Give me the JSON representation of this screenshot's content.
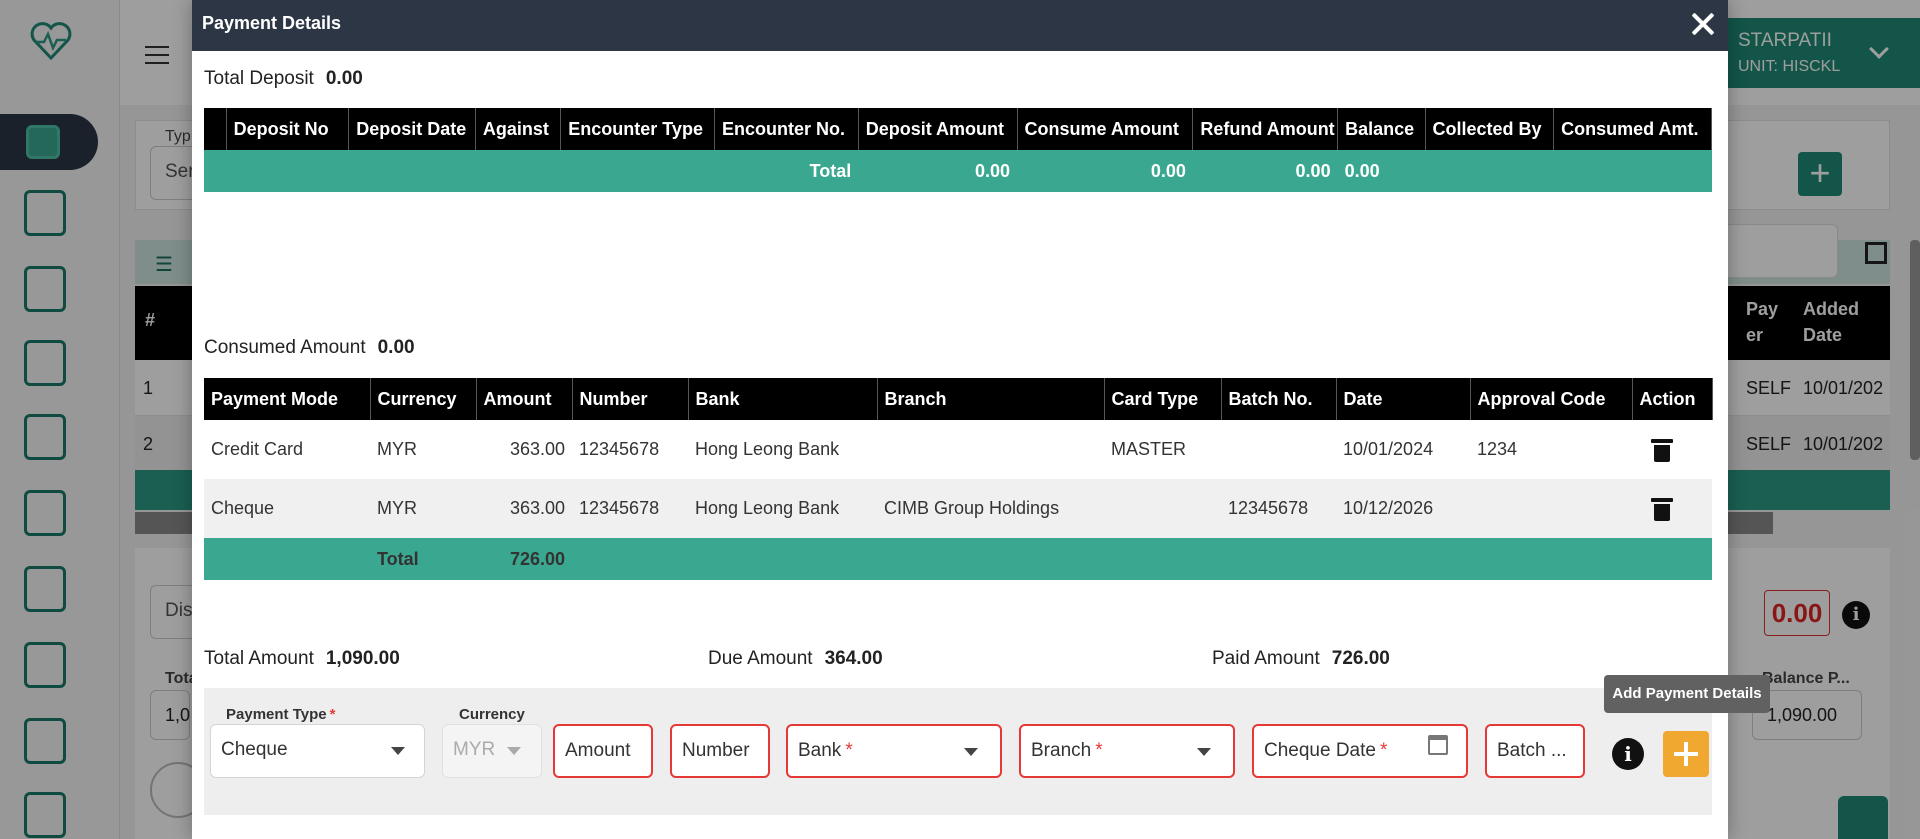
{
  "background": {
    "user_name": "STARPATII",
    "user_unit": "UNIT: HISCKL",
    "type_label": "Typ",
    "type_value": "Ser",
    "headers": [
      "#",
      "Payer",
      "Added Date"
    ],
    "rows": [
      {
        "index": "1",
        "payer": "SELF",
        "date": "10/01/202"
      },
      {
        "index": "2",
        "payer": "SELF",
        "date": "10/01/202"
      }
    ],
    "dis_value": "Dis",
    "balance_value": "0.00",
    "tota_label": "Tota",
    "tota_value": "1,0",
    "balance_p_label": "Balance P...",
    "balance_p_value": "1,090.00"
  },
  "modal": {
    "title": "Payment Details",
    "total_deposit_label": "Total Deposit",
    "total_deposit_value": "0.00",
    "deposit_table": {
      "headers": [
        "Deposit No",
        "Deposit Date",
        "Against",
        "Encounter Type",
        "Encounter No.",
        "Deposit Amount",
        "Consume Amount",
        "Refund Amount",
        "Balance",
        "Collected By",
        "Consumed Amt."
      ],
      "total": {
        "label": "Total",
        "deposit_amount": "0.00",
        "consume_amount": "0.00",
        "refund_amount": "0.00",
        "balance": "0.00"
      }
    },
    "consumed_amount_label": "Consumed Amount",
    "consumed_amount_value": "0.00",
    "payment_table": {
      "headers": [
        "Payment Mode",
        "Currency",
        "Amount",
        "Number",
        "Bank",
        "Branch",
        "Card Type",
        "Batch No.",
        "Date",
        "Approval Code",
        "Action"
      ],
      "rows": [
        {
          "mode": "Credit Card",
          "currency": "MYR",
          "amount": "363.00",
          "number": "12345678",
          "bank": "Hong Leong Bank",
          "branch": "",
          "card_type": "MASTER",
          "batch": "",
          "date": "10/01/2024",
          "approval": "1234"
        },
        {
          "mode": "Cheque",
          "currency": "MYR",
          "amount": "363.00",
          "number": "12345678",
          "bank": "Hong Leong Bank",
          "branch": "CIMB Group Holdings",
          "card_type": "",
          "batch": "12345678",
          "date": "10/12/2026",
          "approval": ""
        }
      ],
      "total": {
        "label": "Total",
        "amount": "726.00"
      }
    },
    "total_amount_label": "Total Amount",
    "total_amount_value": "1,090.00",
    "due_amount_label": "Due Amount",
    "due_amount_value": "364.00",
    "paid_amount_label": "Paid Amount",
    "paid_amount_value": "726.00",
    "form": {
      "payment_type_label": "Payment Type",
      "payment_type_value": "Cheque",
      "currency_label": "Currency",
      "currency_value": "MYR",
      "amount_placeholder": "Amount",
      "number_placeholder": "Number",
      "bank_placeholder": "Bank",
      "branch_placeholder": "Branch",
      "cheque_date_placeholder": "Cheque Date",
      "batch_placeholder": "Batch ...",
      "info_glyph": "i",
      "add_tooltip": "Add Payment Details"
    }
  },
  "colors": {
    "header_bg": "#2c3645",
    "total_row": "#3aa891",
    "required": "#e53935",
    "add_button": "#f0a830"
  }
}
